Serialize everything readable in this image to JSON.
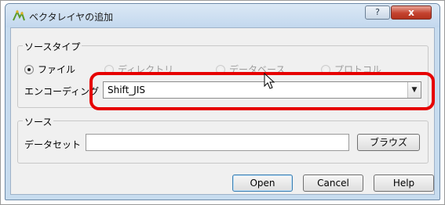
{
  "window": {
    "title": "ベクタレイヤの追加",
    "help_glyph": "?",
    "close_glyph": "x"
  },
  "source_type": {
    "group_title": "ソースタイプ",
    "options": [
      {
        "label": "ファイル",
        "checked": true
      },
      {
        "label": "ディレクトリ",
        "checked": false
      },
      {
        "label": "データベース",
        "checked": false
      },
      {
        "label": "プロトコル",
        "checked": false
      }
    ],
    "encoding_label": "エンコーディング",
    "encoding_value": "Shift_JIS"
  },
  "source": {
    "group_title": "ソース",
    "dataset_label": "データセット",
    "dataset_value": "",
    "browse_label": "ブラウズ"
  },
  "buttons": {
    "open": "Open",
    "cancel": "Cancel",
    "help": "Help"
  },
  "annotation": {
    "highlight_color": "#e60000"
  }
}
